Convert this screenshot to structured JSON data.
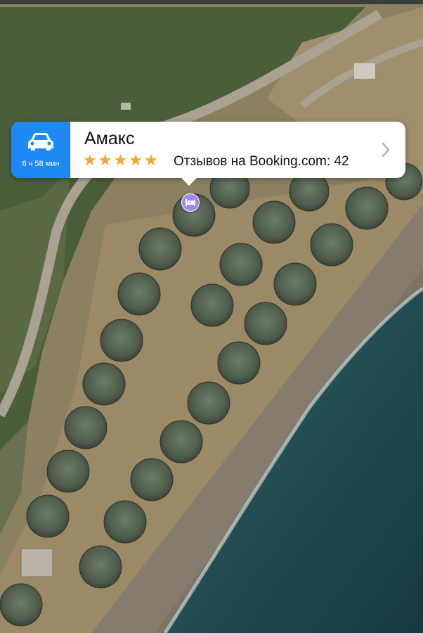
{
  "route": {
    "time": "6 ч 58 мин",
    "icon": "car-icon",
    "color": "#1e88f5"
  },
  "place": {
    "name": "Амакс",
    "rating_stars": 5,
    "reviews_text": "Отзывов на Booking.com: 42",
    "star_color": "#f6a623"
  },
  "map": {
    "pin_icon": "bed-icon",
    "pin_color": "#9b8cf5",
    "view": "satellite"
  }
}
